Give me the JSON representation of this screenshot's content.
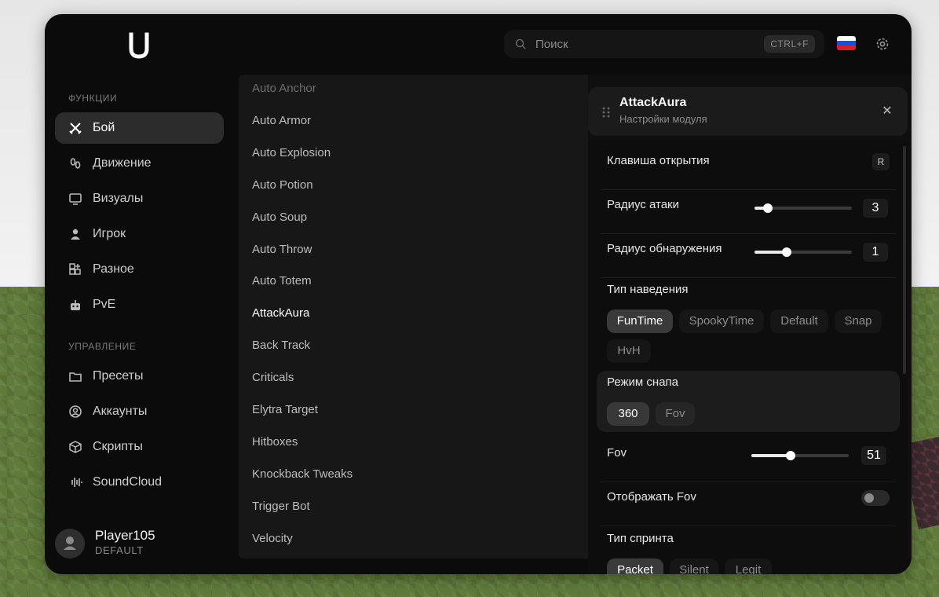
{
  "search": {
    "placeholder": "Поиск",
    "shortcut": "CTRL+F"
  },
  "sidebar": {
    "sections": [
      {
        "label": "ФУНКЦИИ",
        "items": [
          {
            "label": "Бой",
            "icon": "swords-icon",
            "active": true
          },
          {
            "label": "Движение",
            "icon": "footsteps-icon"
          },
          {
            "label": "Визуалы",
            "icon": "monitor-icon"
          },
          {
            "label": "Игрок",
            "icon": "user-icon"
          },
          {
            "label": "Разное",
            "icon": "grid-plus-icon"
          },
          {
            "label": "PvE",
            "icon": "robot-icon"
          }
        ]
      },
      {
        "label": "УПРАВЛЕНИЕ",
        "items": [
          {
            "label": "Пресеты",
            "icon": "folder-icon"
          },
          {
            "label": "Аккаунты",
            "icon": "account-circle-icon"
          },
          {
            "label": "Скрипты",
            "icon": "cube-icon"
          },
          {
            "label": "SoundCloud",
            "icon": "soundwave-icon"
          }
        ]
      }
    ]
  },
  "profile": {
    "name": "Player105",
    "role": "DEFAULT"
  },
  "modules": [
    "Auto Anchor",
    "Auto Armor",
    "Auto Explosion",
    "Auto Potion",
    "Auto Soup",
    "Auto Throw",
    "Auto Totem",
    "AttackAura",
    "Back Track",
    "Criticals",
    "Elytra Target",
    "Hitboxes",
    "Knockback Tweaks",
    "Trigger Bot",
    "Velocity"
  ],
  "selected_module": "AttackAura",
  "panel": {
    "title": "AttackAura",
    "subtitle": "Настройки модуля",
    "open_key_label": "Клавиша открытия",
    "open_key": "R",
    "attack_radius": {
      "label": "Радиус атаки",
      "value": "3",
      "fraction": 0.14
    },
    "detect_radius": {
      "label": "Радиус обнаружения",
      "value": "1",
      "fraction": 0.33
    },
    "aim_type": {
      "label": "Тип наведения",
      "options": [
        "FunTime",
        "SpookyTime",
        "Default",
        "Snap",
        "HvH"
      ],
      "selected": "FunTime"
    },
    "snap_mode": {
      "label": "Режим снапа",
      "options": [
        "360",
        "Fov"
      ],
      "selected": "360"
    },
    "fov": {
      "label": "Fov",
      "value": "51",
      "fraction": 0.4
    },
    "show_fov": {
      "label": "Отображать Fov",
      "enabled": false
    },
    "sprint_type": {
      "label": "Тип спринта",
      "options": [
        "Packet",
        "Silent",
        "Legit"
      ],
      "selected": "Packet"
    }
  },
  "colors": {
    "accent": "#ffffff",
    "panel": "#0b0b0b",
    "active_bg": "#2c2c2c"
  }
}
